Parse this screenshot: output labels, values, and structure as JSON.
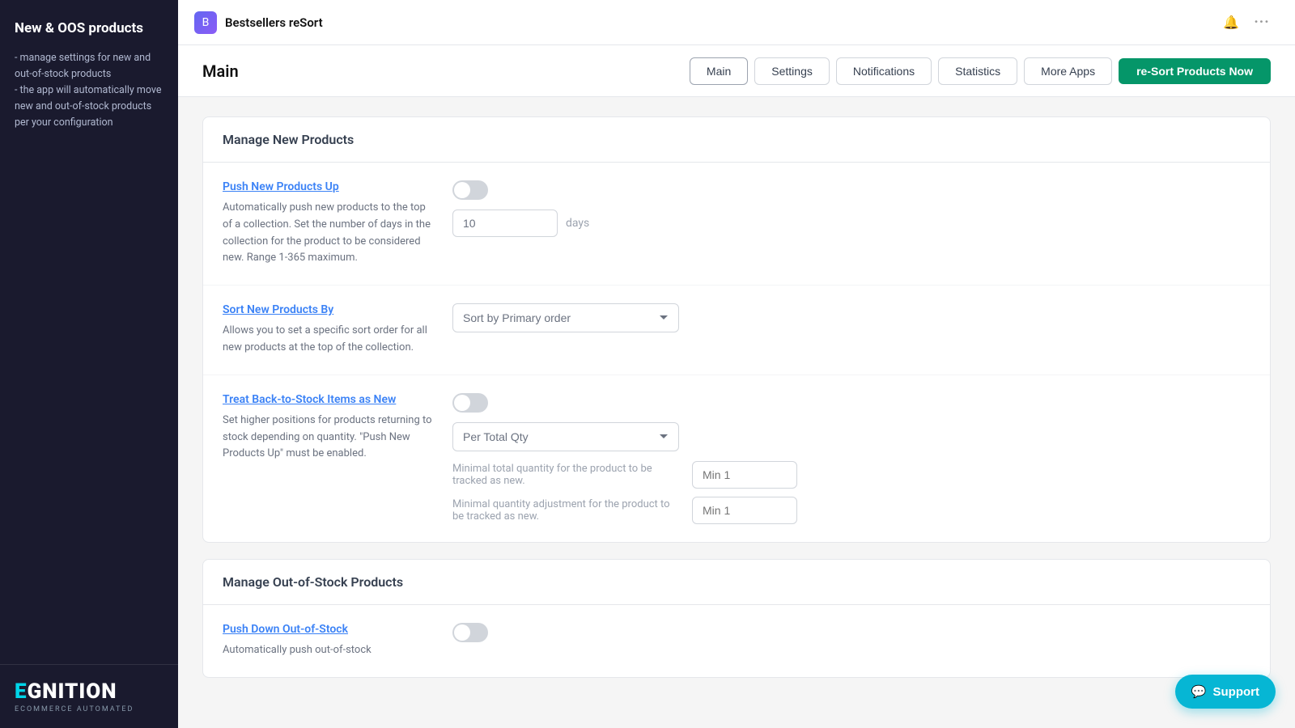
{
  "sidebar": {
    "title": "New & OOS products",
    "description": "- manage settings for new and out-of-stock products\n- the app will automatically move new and out-of-stock products per your configuration",
    "brand_name_highlight": "E",
    "brand_name_rest": "GNITION",
    "brand_tagline": "ECOMMERCE AUTOMATED"
  },
  "topbar": {
    "app_icon": "B",
    "app_name": "Bestsellers reSort",
    "bell_icon": "🔔",
    "more_icon": "···"
  },
  "header": {
    "page_title": "Main",
    "nav": {
      "main_label": "Main",
      "settings_label": "Settings",
      "notifications_label": "Notifications",
      "statistics_label": "Statistics",
      "more_apps_label": "More Apps",
      "resort_label": "re-Sort Products Now"
    }
  },
  "manage_new": {
    "section_title": "Manage New Products",
    "push_new_up": {
      "title": "Push New Products Up",
      "description": "Automatically push new products to the top of a collection. Set the number of days in the collection for the product to be considered new. Range 1-365 maximum.",
      "toggle_on": false,
      "days_value": "10",
      "days_label": "days"
    },
    "sort_new_by": {
      "title": "Sort New Products By",
      "description": "Allows you to set a specific sort order for all new products at the top of the collection.",
      "select_value": "Sort by Primary order"
    },
    "treat_back": {
      "title": "Treat Back-to-Stock Items as New",
      "description": "Set higher positions for products returning to stock depending on quantity. \"Push New Products Up\" must be enabled.",
      "toggle_on": false,
      "select_value": "Per Total Qty",
      "min_qty_label": "Minimal total quantity for the product to be tracked as new.",
      "min_qty_placeholder": "Min 1",
      "min_adj_label": "Minimal quantity adjustment for the product to be tracked as new.",
      "min_adj_placeholder": "Min 1"
    }
  },
  "manage_oos": {
    "section_title": "Manage Out-of-Stock Products",
    "push_down": {
      "title": "Push Down Out-of-Stock",
      "description": "Automatically push out-of-stock",
      "toggle_on": false
    }
  },
  "support": {
    "icon": "💬",
    "label": "Support"
  }
}
